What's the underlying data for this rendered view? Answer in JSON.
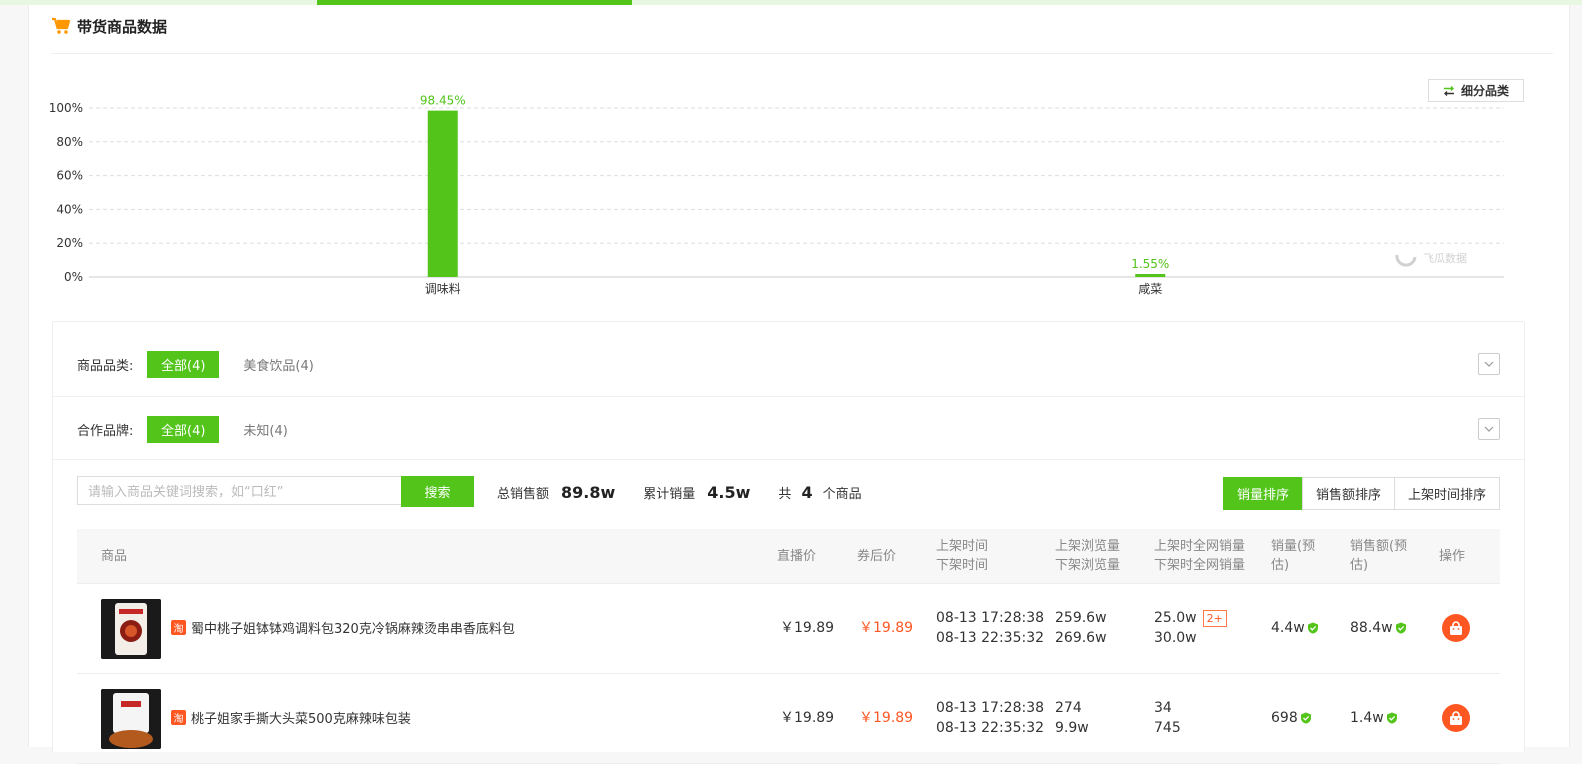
{
  "header": {
    "title": "带货商品数据"
  },
  "subdivide_button": {
    "label": "细分品类"
  },
  "chart_data": {
    "type": "bar",
    "categories": [
      "调味料",
      "咸菜"
    ],
    "values": [
      98.45,
      1.55
    ],
    "value_labels": [
      "98.45%",
      "1.55%"
    ],
    "yticks": [
      "100%",
      "80%",
      "60%",
      "40%",
      "20%",
      "0%"
    ],
    "ylim": [
      0,
      100
    ],
    "grid": true,
    "color": "#52c41a",
    "watermark": "飞瓜数据"
  },
  "filters": {
    "category": {
      "label": "商品品类:",
      "options": [
        "全部(4)",
        "美食饮品(4)"
      ],
      "selected": 0
    },
    "brand": {
      "label": "合作品牌:",
      "options": [
        "全部(4)",
        "未知(4)"
      ],
      "selected": 0
    }
  },
  "search": {
    "placeholder": "请输入商品关键词搜索，如“口红”",
    "button": "搜索"
  },
  "stats": {
    "total_sales_label": "总销售额",
    "total_sales_value": "89.8w",
    "total_volume_label": "累计销量",
    "total_volume_value": "4.5w",
    "count_prefix": "共",
    "count_value": "4",
    "count_suffix": "个商品"
  },
  "sort": {
    "options": [
      "销量排序",
      "销售额排序",
      "上架时间排序"
    ],
    "selected": 0
  },
  "table": {
    "headers": {
      "product": "商品",
      "live_price": "直播价",
      "coupon_price": "券后价",
      "list_time": "上架时间",
      "delist_time": "下架时间",
      "list_views": "上架浏览量",
      "delist_views": "下架浏览量",
      "list_net_sales": "上架时全网销量",
      "delist_net_sales": "下架时全网销量",
      "sales_est": "销量(预估)",
      "revenue_est": "销售额(预估)",
      "action": "操作"
    },
    "rows": [
      {
        "platform": "淘",
        "name": "蜀中桃子姐钵钵鸡调料包320克冷锅麻辣烫串串香底料包",
        "live_price": "￥19.89",
        "coupon_price": "￥19.89",
        "list_time": "08-13 17:28:38",
        "delist_time": "08-13 22:35:32",
        "list_views": "259.6w",
        "delist_views": "269.6w",
        "list_net_sales": "25.0w",
        "delist_net_sales": "30.0w",
        "extra_badge": "2+",
        "sales_est": "4.4w",
        "revenue_est": "88.4w"
      },
      {
        "platform": "淘",
        "name": "桃子姐家手撕大头菜500克麻辣味包装",
        "live_price": "￥19.89",
        "coupon_price": "￥19.89",
        "list_time": "08-13 17:28:38",
        "delist_time": "08-13 22:35:32",
        "list_views": "274",
        "delist_views": "9.9w",
        "list_net_sales": "34",
        "delist_net_sales": "745",
        "sales_est": "698",
        "revenue_est": "1.4w"
      }
    ]
  }
}
